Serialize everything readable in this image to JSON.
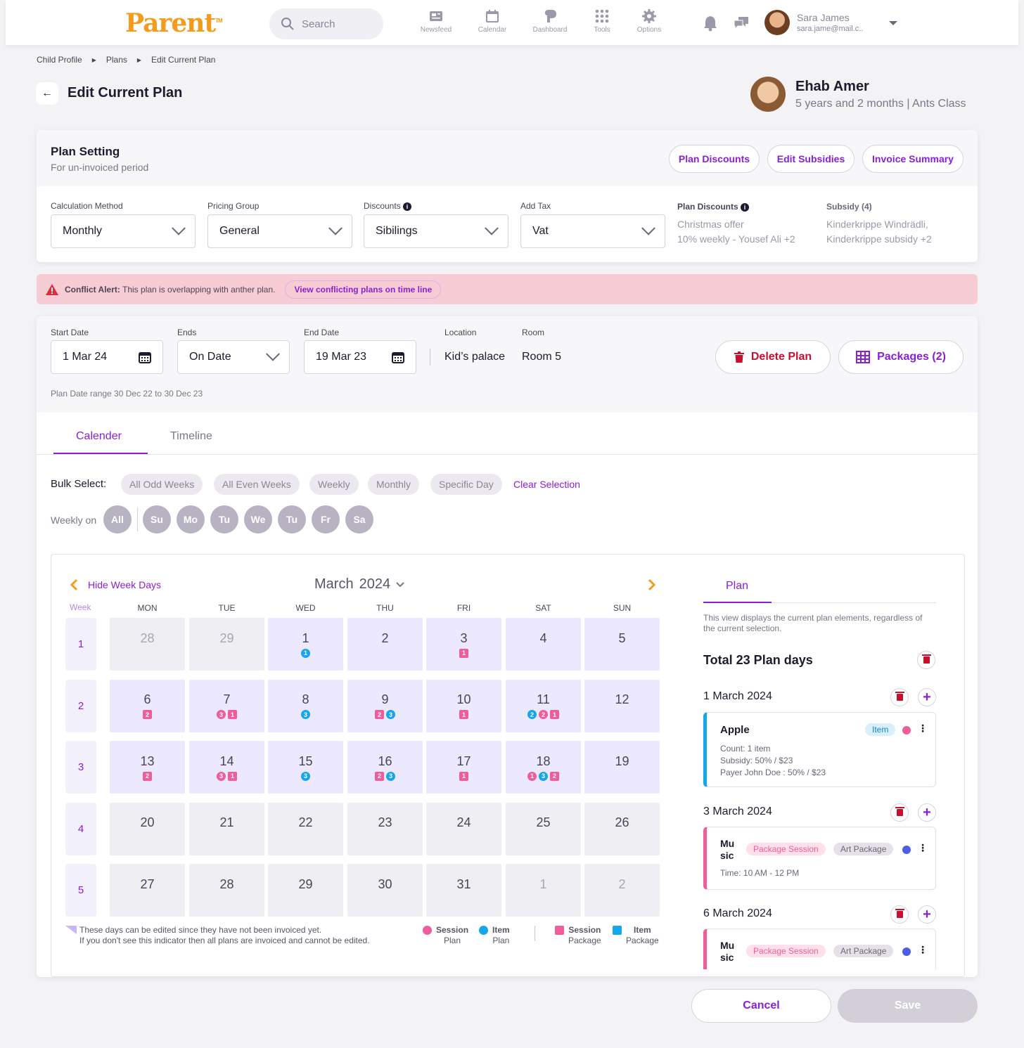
{
  "topbar": {
    "logo": "Parent",
    "logo_tm": "TM",
    "search_placeholder": "Search",
    "nav": [
      {
        "label": "Newsfeed",
        "icon": "newsfeed-icon"
      },
      {
        "label": "Calendar",
        "icon": "calendar-icon"
      },
      {
        "label": "Dashboard",
        "icon": "dashboard-icon"
      },
      {
        "label": "Tools",
        "icon": "tools-icon"
      },
      {
        "label": "Options",
        "icon": "gear-icon"
      }
    ],
    "user": {
      "name": "Sara James",
      "email": "sara.jame@mail.c.."
    }
  },
  "breadcrumb": [
    "Child Profile",
    "Plans",
    "Edit Current Plan"
  ],
  "page_title": "Edit Current Plan",
  "child": {
    "name": "Ehab Amer",
    "age": "5 years and 2 months",
    "class": "Ants Class"
  },
  "plan_setting": {
    "title": "Plan Setting",
    "subtitle": "For un-invoiced period",
    "buttons": [
      "Plan Discounts",
      "Edit Subsidies",
      "Invoice Summary"
    ],
    "calc_label": "Calculation Method",
    "calc_value": "Monthly",
    "pricing_label": "Pricing Group",
    "pricing_value": "General",
    "discounts_label": "Discounts",
    "discounts_value": "Sibilings",
    "tax_label": "Add Tax",
    "tax_value": "Vat",
    "plan_discounts_label": "Plan Discounts",
    "plan_discounts_lines": [
      "Christmas offer",
      "10% weekly - Yousef Ali +2"
    ],
    "subsidy_label": "Subsidy (4)",
    "subsidy_lines": [
      "Kinderkrippe Windrädli,",
      "Kinderkrippe subsidy +2"
    ]
  },
  "alert": {
    "label": "Conflict Alert:",
    "text": "This plan is overlapping with anther plan.",
    "link": "View conflicting plans on time line"
  },
  "dates": {
    "start_label": "Start Date",
    "start_value": "1 Mar 24",
    "ends_label": "Ends",
    "ends_value": "On Date",
    "end_label": "End Date",
    "end_value": "19 Mar 23",
    "location_label": "Location",
    "location_value": "Kid’s palace",
    "room_label": "Room",
    "room_value": "Room 5",
    "delete": "Delete Plan",
    "packages": "Packages (2)",
    "range_note": "Plan Date range 30 Dec 22 to 30 Dec 23"
  },
  "tabs": [
    "Calender",
    "Timeline"
  ],
  "bulk": {
    "label": "Bulk Select:",
    "chips": [
      "All Odd Weeks",
      "All Even Weeks",
      "Weekly",
      "Monthly",
      "Specific Day"
    ],
    "clear": "Clear Selection",
    "weekly_label": "Weekly on",
    "days": [
      "All",
      "Su",
      "Mo",
      "Tu",
      "We",
      "Tu",
      "Fr",
      "Sa"
    ]
  },
  "calendar": {
    "hide": "Hide Week Days",
    "month": "March",
    "year": "2024",
    "week_label": "Week",
    "headers": [
      "MON",
      "TUE",
      "WED",
      "THU",
      "FRI",
      "SAT",
      "SUN"
    ],
    "weeks": [
      {
        "num": "1",
        "days": [
          {
            "d": "28",
            "s": "faint",
            "b": []
          },
          {
            "d": "29",
            "s": "faint",
            "b": []
          },
          {
            "d": "1",
            "s": "plan",
            "b": [
              [
                "c",
                "blue",
                "1"
              ]
            ]
          },
          {
            "d": "2",
            "s": "plan",
            "b": []
          },
          {
            "d": "3",
            "s": "plan",
            "b": [
              [
                "sq",
                "pink",
                "1"
              ]
            ]
          },
          {
            "d": "4",
            "s": "plan",
            "b": []
          },
          {
            "d": "5",
            "s": "plan",
            "b": []
          }
        ]
      },
      {
        "num": "2",
        "days": [
          {
            "d": "6",
            "s": "plan",
            "b": [
              [
                "sq",
                "pink",
                "2"
              ]
            ]
          },
          {
            "d": "7",
            "s": "plan",
            "b": [
              [
                "c",
                "pink",
                "3"
              ],
              [
                "sq",
                "pink",
                "1"
              ]
            ]
          },
          {
            "d": "8",
            "s": "plan",
            "b": [
              [
                "c",
                "blue",
                "3"
              ]
            ]
          },
          {
            "d": "9",
            "s": "plan",
            "b": [
              [
                "sq",
                "pink",
                "2"
              ],
              [
                "c",
                "blue",
                "3"
              ]
            ]
          },
          {
            "d": "10",
            "s": "plan",
            "b": [
              [
                "sq",
                "pink",
                "1"
              ]
            ]
          },
          {
            "d": "11",
            "s": "plan",
            "b": [
              [
                "c",
                "blue",
                "2"
              ],
              [
                "c",
                "pink",
                "2"
              ],
              [
                "sq",
                "pink",
                "1"
              ]
            ]
          },
          {
            "d": "12",
            "s": "plan",
            "b": []
          }
        ]
      },
      {
        "num": "3",
        "days": [
          {
            "d": "13",
            "s": "plan",
            "b": [
              [
                "sq",
                "pink",
                "2"
              ]
            ]
          },
          {
            "d": "14",
            "s": "plan",
            "b": [
              [
                "c",
                "pink",
                "3"
              ],
              [
                "sq",
                "pink",
                "1"
              ]
            ]
          },
          {
            "d": "15",
            "s": "plan",
            "b": [
              [
                "c",
                "blue",
                "3"
              ]
            ]
          },
          {
            "d": "16",
            "s": "plan",
            "b": [
              [
                "sq",
                "pink",
                "2"
              ],
              [
                "c",
                "blue",
                "3"
              ]
            ]
          },
          {
            "d": "17",
            "s": "plan",
            "b": [
              [
                "sq",
                "pink",
                "1"
              ]
            ]
          },
          {
            "d": "18",
            "s": "plan",
            "b": [
              [
                "c",
                "pink",
                "1"
              ],
              [
                "c",
                "blue",
                "3"
              ],
              [
                "sq",
                "pink",
                "2"
              ]
            ]
          },
          {
            "d": "19",
            "s": "plan",
            "b": []
          }
        ]
      },
      {
        "num": "4",
        "days": [
          {
            "d": "20",
            "s": "grey",
            "b": []
          },
          {
            "d": "21",
            "s": "grey",
            "b": []
          },
          {
            "d": "22",
            "s": "grey",
            "b": []
          },
          {
            "d": "23",
            "s": "grey",
            "b": []
          },
          {
            "d": "24",
            "s": "grey",
            "b": []
          },
          {
            "d": "25",
            "s": "grey",
            "b": []
          },
          {
            "d": "26",
            "s": "grey",
            "b": []
          }
        ]
      },
      {
        "num": "5",
        "days": [
          {
            "d": "27",
            "s": "grey",
            "b": []
          },
          {
            "d": "28",
            "s": "grey",
            "b": []
          },
          {
            "d": "29",
            "s": "grey",
            "b": []
          },
          {
            "d": "30",
            "s": "grey",
            "b": []
          },
          {
            "d": "31",
            "s": "grey",
            "b": []
          },
          {
            "d": "1",
            "s": "faint",
            "b": []
          },
          {
            "d": "2",
            "s": "faint",
            "b": []
          }
        ]
      }
    ],
    "note1": "These days can be edited since they have not been invoiced yet.",
    "note2": "If you don't see this indicator then all plans are invoiced and cannot be edited.",
    "legend": [
      {
        "shape": "circle",
        "color": "#ef5d9a",
        "t1": "Session",
        "t2": "Plan"
      },
      {
        "shape": "circle",
        "color": "#15a6ec",
        "t1": "Item",
        "t2": "Plan"
      },
      {
        "shape": "square",
        "color": "#ef5d9a",
        "t1": "Session",
        "t2": "Package"
      },
      {
        "shape": "square",
        "color": "#15a6ec",
        "t1": "Item",
        "t2": "Package"
      }
    ]
  },
  "plan_panel": {
    "tab": "Plan",
    "desc": "This view displays the current plan elements, regardless of the current selection.",
    "total": "Total 23 Plan days",
    "entries": [
      {
        "date": "1 March 2024",
        "name": "Apple",
        "tag": "Item",
        "line1": "Count: 1 item",
        "line2": "Subsidy: 50% / $23",
        "line3": "Payer John Doe : 50% / $23"
      },
      {
        "date": "3 March 2024",
        "name": "Mu sic",
        "tag1": "Package Session",
        "tag2": "Art Package",
        "time_label": "Time:",
        "time": "10 AM - 12 PM"
      },
      {
        "date": "6 March 2024",
        "name": "Mu sic",
        "tag1": "Package Session",
        "tag2": "Art Package"
      }
    ]
  },
  "footer": {
    "cancel": "Cancel",
    "save": "Save"
  },
  "colors": {
    "accent": "#8a1fd6",
    "brand": "#f39b1a",
    "danger": "#c8102e",
    "alert_bg": "#f8ccd4"
  }
}
